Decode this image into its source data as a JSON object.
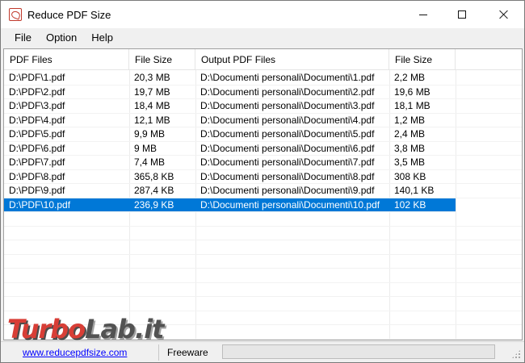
{
  "window": {
    "title": "Reduce PDF Size",
    "icon": "pdf-app-icon"
  },
  "menu": {
    "items": [
      "File",
      "Option",
      "Help"
    ]
  },
  "table": {
    "headers": [
      "PDF Files",
      "File Size",
      "Output PDF Files",
      "File Size"
    ],
    "rows": [
      [
        "D:\\PDF\\1.pdf",
        "20,3 MB",
        "D:\\Documenti personali\\Documenti\\1.pdf",
        "2,2 MB"
      ],
      [
        "D:\\PDF\\2.pdf",
        "19,7 MB",
        "D:\\Documenti personali\\Documenti\\2.pdf",
        "19,6 MB"
      ],
      [
        "D:\\PDF\\3.pdf",
        "18,4 MB",
        "D:\\Documenti personali\\Documenti\\3.pdf",
        "18,1 MB"
      ],
      [
        "D:\\PDF\\4.pdf",
        "12,1 MB",
        "D:\\Documenti personali\\Documenti\\4.pdf",
        "1,2 MB"
      ],
      [
        "D:\\PDF\\5.pdf",
        "9,9 MB",
        "D:\\Documenti personali\\Documenti\\5.pdf",
        "2,4 MB"
      ],
      [
        "D:\\PDF\\6.pdf",
        "9 MB",
        "D:\\Documenti personali\\Documenti\\6.pdf",
        "3,8 MB"
      ],
      [
        "D:\\PDF\\7.pdf",
        "7,4 MB",
        "D:\\Documenti personali\\Documenti\\7.pdf",
        "3,5 MB"
      ],
      [
        "D:\\PDF\\8.pdf",
        "365,8 KB",
        "D:\\Documenti personali\\Documenti\\8.pdf",
        "308 KB"
      ],
      [
        "D:\\PDF\\9.pdf",
        "287,4 KB",
        "D:\\Documenti personali\\Documenti\\9.pdf",
        "140,1 KB"
      ],
      [
        "D:\\PDF\\10.pdf",
        "236,9 KB",
        "D:\\Documenti personali\\Documenti\\10.pdf",
        "102 KB"
      ]
    ],
    "selected_row": 9
  },
  "status": {
    "link": "www.reducepdfsize.com",
    "label": "Freeware",
    "progress": 0
  },
  "watermark": {
    "part1": "Turbo",
    "part2": "Lab.it"
  },
  "colors": {
    "selection": "#0078d7",
    "link": "#0000ff"
  }
}
